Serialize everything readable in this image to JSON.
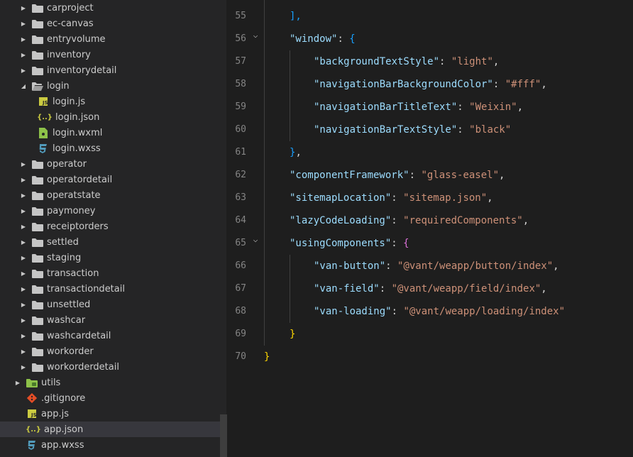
{
  "explorer": {
    "items": [
      {
        "label": "carproject",
        "kind": "folder",
        "state": "closed",
        "depth": 1
      },
      {
        "label": "ec-canvas",
        "kind": "folder",
        "state": "closed",
        "depth": 1
      },
      {
        "label": "entryvolume",
        "kind": "folder",
        "state": "closed",
        "depth": 1
      },
      {
        "label": "inventory",
        "kind": "folder",
        "state": "closed",
        "depth": 1
      },
      {
        "label": "inventorydetail",
        "kind": "folder",
        "state": "closed",
        "depth": 1
      },
      {
        "label": "login",
        "kind": "folder",
        "state": "open",
        "depth": 1
      },
      {
        "label": "login.js",
        "kind": "js",
        "depth": 2
      },
      {
        "label": "login.json",
        "kind": "json",
        "depth": 2
      },
      {
        "label": "login.wxml",
        "kind": "wxml",
        "depth": 2
      },
      {
        "label": "login.wxss",
        "kind": "wxss",
        "depth": 2
      },
      {
        "label": "operator",
        "kind": "folder",
        "state": "closed",
        "depth": 1
      },
      {
        "label": "operatordetail",
        "kind": "folder",
        "state": "closed",
        "depth": 1
      },
      {
        "label": "operatstate",
        "kind": "folder",
        "state": "closed",
        "depth": 1
      },
      {
        "label": "paymoney",
        "kind": "folder",
        "state": "closed",
        "depth": 1
      },
      {
        "label": "receiptorders",
        "kind": "folder",
        "state": "closed",
        "depth": 1
      },
      {
        "label": "settled",
        "kind": "folder",
        "state": "closed",
        "depth": 1
      },
      {
        "label": "staging",
        "kind": "folder",
        "state": "closed",
        "depth": 1
      },
      {
        "label": "transaction",
        "kind": "folder",
        "state": "closed",
        "depth": 1
      },
      {
        "label": "transactiondetail",
        "kind": "folder",
        "state": "closed",
        "depth": 1
      },
      {
        "label": "unsettled",
        "kind": "folder",
        "state": "closed",
        "depth": 1
      },
      {
        "label": "washcar",
        "kind": "folder",
        "state": "closed",
        "depth": 1
      },
      {
        "label": "washcardetail",
        "kind": "folder",
        "state": "closed",
        "depth": 1
      },
      {
        "label": "workorder",
        "kind": "folder",
        "state": "closed",
        "depth": 1
      },
      {
        "label": "workorderdetail",
        "kind": "folder",
        "state": "closed",
        "depth": 1
      },
      {
        "label": "utils",
        "kind": "folder-special",
        "state": "closed",
        "depth": 0
      },
      {
        "label": ".gitignore",
        "kind": "git",
        "depth": 0
      },
      {
        "label": "app.js",
        "kind": "js",
        "depth": 0
      },
      {
        "label": "app.json",
        "kind": "json",
        "depth": 0,
        "selected": true
      },
      {
        "label": "app.wxss",
        "kind": "wxss",
        "depth": 0
      }
    ]
  },
  "icons": {
    "folder": "folder-icon",
    "folder-special": "utils-folder-icon",
    "js": "js-file-icon",
    "json": "json-file-icon",
    "wxml": "wxml-file-icon",
    "wxss": "css-file-icon",
    "git": "git-file-icon",
    "chevron_closed": "chevron-right-icon",
    "chevron_open": "chevron-down-icon"
  },
  "colors": {
    "sidebar_bg": "#252526",
    "editor_bg": "#1e1e1e",
    "selected_row": "#37373d",
    "folder": "#c5c5c5",
    "js_icon": "#cbcb41",
    "json_icon": "#cbcb41",
    "wxml_icon": "#8dc149",
    "css_icon": "#519aba",
    "git_icon": "#e44d26",
    "key": "#9cdcfe",
    "string": "#ce9178",
    "brace_level1": "#ffd700",
    "brace_level2": "#da70d6",
    "brace_level3": "#179fff",
    "line_number": "#858585"
  },
  "editor": {
    "lines": [
      {
        "n": "55",
        "fold": false,
        "indent": 1,
        "tokens": [
          [
            "],",
            "brace3"
          ]
        ]
      },
      {
        "n": "56",
        "fold": true,
        "indent": 1,
        "tokens": [
          [
            "\"window\"",
            "key"
          ],
          [
            ": ",
            "punc"
          ],
          [
            "{",
            "brace3"
          ]
        ]
      },
      {
        "n": "57",
        "fold": false,
        "indent": 2,
        "tokens": [
          [
            "\"backgroundTextStyle\"",
            "key"
          ],
          [
            ": ",
            "punc"
          ],
          [
            "\"light\"",
            "str"
          ],
          [
            ",",
            "punc"
          ]
        ]
      },
      {
        "n": "58",
        "fold": false,
        "indent": 2,
        "tokens": [
          [
            "\"navigationBarBackgroundColor\"",
            "key"
          ],
          [
            ": ",
            "punc"
          ],
          [
            "\"#fff\"",
            "str"
          ],
          [
            ",",
            "punc"
          ]
        ]
      },
      {
        "n": "59",
        "fold": false,
        "indent": 2,
        "tokens": [
          [
            "\"navigationBarTitleText\"",
            "key"
          ],
          [
            ": ",
            "punc"
          ],
          [
            "\"Weixin\"",
            "str"
          ],
          [
            ",",
            "punc"
          ]
        ]
      },
      {
        "n": "60",
        "fold": false,
        "indent": 2,
        "tokens": [
          [
            "\"navigationBarTextStyle\"",
            "key"
          ],
          [
            ": ",
            "punc"
          ],
          [
            "\"black\"",
            "str"
          ]
        ]
      },
      {
        "n": "61",
        "fold": false,
        "indent": 1,
        "tokens": [
          [
            "}",
            "brace3"
          ],
          [
            ",",
            "punc"
          ]
        ]
      },
      {
        "n": "62",
        "fold": false,
        "indent": 1,
        "tokens": [
          [
            "\"componentFramework\"",
            "key"
          ],
          [
            ": ",
            "punc"
          ],
          [
            "\"glass-easel\"",
            "str"
          ],
          [
            ",",
            "punc"
          ]
        ]
      },
      {
        "n": "63",
        "fold": false,
        "indent": 1,
        "tokens": [
          [
            "\"sitemapLocation\"",
            "key"
          ],
          [
            ": ",
            "punc"
          ],
          [
            "\"sitemap.json\"",
            "str"
          ],
          [
            ",",
            "punc"
          ]
        ]
      },
      {
        "n": "64",
        "fold": false,
        "indent": 1,
        "tokens": [
          [
            "\"lazyCodeLoading\"",
            "key"
          ],
          [
            ": ",
            "punc"
          ],
          [
            "\"requiredComponents\"",
            "str"
          ],
          [
            ",",
            "punc"
          ]
        ]
      },
      {
        "n": "65",
        "fold": true,
        "indent": 1,
        "tokens": [
          [
            "\"usingComponents\"",
            "key"
          ],
          [
            ": ",
            "punc"
          ],
          [
            "{",
            "brace1"
          ]
        ]
      },
      {
        "n": "66",
        "fold": false,
        "indent": 2,
        "tokens": [
          [
            "\"van-button\"",
            "key"
          ],
          [
            ": ",
            "punc"
          ],
          [
            "\"@vant/weapp/button/index\"",
            "str"
          ],
          [
            ",",
            "punc"
          ]
        ]
      },
      {
        "n": "67",
        "fold": false,
        "indent": 2,
        "tokens": [
          [
            "\"van-field\"",
            "key"
          ],
          [
            ": ",
            "punc"
          ],
          [
            "\"@vant/weapp/field/index\"",
            "str"
          ],
          [
            ",",
            "punc"
          ]
        ]
      },
      {
        "n": "68",
        "fold": false,
        "indent": 2,
        "tokens": [
          [
            "\"van-loading\"",
            "key"
          ],
          [
            ": ",
            "punc"
          ],
          [
            "\"@vant/weapp/loading/index\"",
            "str"
          ]
        ]
      },
      {
        "n": "69",
        "fold": false,
        "indent": 1,
        "tokens": [
          [
            "}",
            "brace2"
          ]
        ]
      },
      {
        "n": "70",
        "fold": false,
        "indent": 0,
        "tokens": [
          [
            "}",
            "brace2"
          ]
        ]
      }
    ]
  }
}
